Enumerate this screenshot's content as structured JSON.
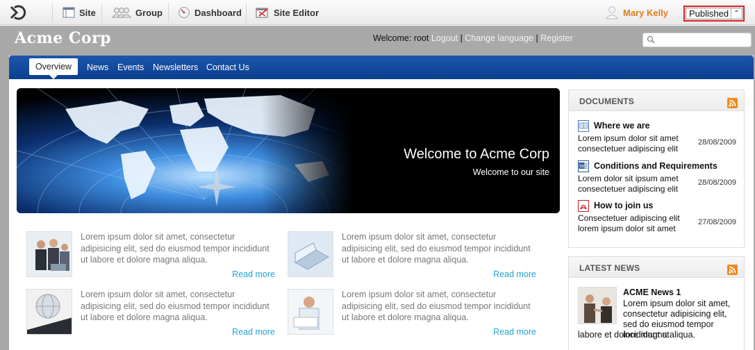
{
  "adminbar": {
    "site_label": "Site",
    "group_label": "Group",
    "dashboard_label": "Dashboard",
    "site_editor_label": "Site Editor",
    "user_name": "Mary Kelly",
    "publish_state": "Published"
  },
  "site": {
    "title": "Acme Corp",
    "welcome_prefix": "Welcome: root",
    "logout": "Logout",
    "change_language": "Change language",
    "register": "Register",
    "sep": "|",
    "search_placeholder": ""
  },
  "nav": {
    "active": "Overview",
    "items": [
      "News",
      "Events",
      "Newsletters",
      "Contact Us"
    ]
  },
  "hero": {
    "title": "Welcome to Acme Corp",
    "subtitle": "Welcome to our site"
  },
  "teasers": [
    {
      "text": "Lorem ipsum dolor sit amet, consectetur adipisicing elit, sed do eiusmod tempor incididunt ut labore et dolore magna aliqua.",
      "more": "Read more"
    },
    {
      "text": "Lorem ipsum dolor sit amet, consectetur adipisicing elit, sed do eiusmod tempor incididunt ut labore et dolore magna aliqua.",
      "more": "Read more"
    },
    {
      "text": "Lorem ipsum dolor sit amet, consectetur adipisicing elit, sed do eiusmod tempor incididunt ut labore et dolore magna aliqua.",
      "more": "Read more"
    },
    {
      "text": "Lorem ipsum dolor sit amet, consectetur adipisicing elit, sed do eiusmod tempor incididunt ut labore et dolore magna aliqua.",
      "more": "Read more"
    }
  ],
  "documents": {
    "heading": "DOCUMENTS",
    "items": [
      {
        "name": "Where we are",
        "desc": "Lorem ipsum dolor sit amet consectetuer adipiscing elit",
        "date": "28/08/2009",
        "icon": "spreadsheet-icon"
      },
      {
        "name": "Conditions and Requirements",
        "desc": "Lorem dolor sit ipsum amet consectetuer adipiscing elit",
        "date": "28/08/2009",
        "icon": "word-document-icon"
      },
      {
        "name": "How to join us",
        "desc": "Consectetuer adipiscing elit lorem ipsum dolor sit amet",
        "date": "27/08/2009",
        "icon": "pdf-icon"
      }
    ]
  },
  "latest_news": {
    "heading": "LATEST NEWS",
    "title": "ACME News 1",
    "text_a": "Lorem ipsum dolor sit amet, consectetur adipisicing elit, sed do eiusmod tempor incididunt ut",
    "text_b": "labore et dolore magna aliqua."
  },
  "colors": {
    "nav_blue": "#0f4597",
    "link_cyan": "#22a3cf",
    "user_orange": "#e07b1a",
    "rss_orange": "#f08a1e",
    "highlight_red": "#d9201f"
  }
}
